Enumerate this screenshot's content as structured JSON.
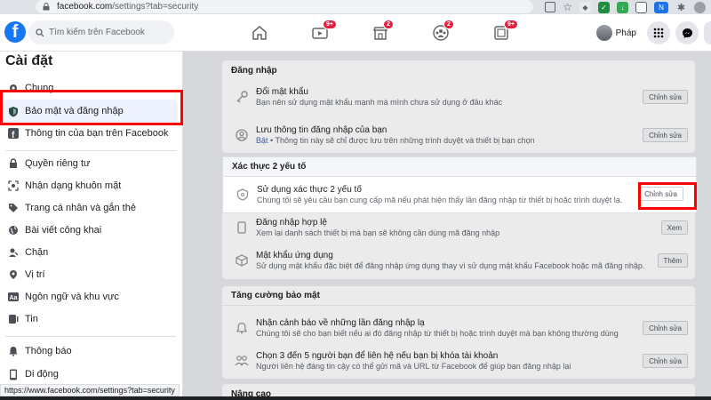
{
  "browser": {
    "url_host": "facebook.com",
    "url_path": "/settings?tab=security"
  },
  "header": {
    "search_placeholder": "Tìm kiếm trên Facebook",
    "profile_name": "Pháp",
    "badges": {
      "watch": "9+",
      "marketplace": "2",
      "groups": "2",
      "gaming": "9+"
    }
  },
  "sidebar": {
    "title": "Cài đặt",
    "items": [
      {
        "label": "Chung",
        "icon": "gear-icon"
      },
      {
        "label": "Bảo mật và đăng nhập",
        "icon": "shield-icon"
      },
      {
        "label": "Thông tin của bạn trên Facebook",
        "icon": "facebook-icon"
      },
      {
        "label": "Quyền riêng tư",
        "icon": "lock-icon"
      },
      {
        "label": "Nhận dạng khuôn mặt",
        "icon": "face-icon"
      },
      {
        "label": "Trang cá nhân và gắn thẻ",
        "icon": "tag-icon"
      },
      {
        "label": "Bài viết công khai",
        "icon": "globe-icon"
      },
      {
        "label": "Chặn",
        "icon": "block-icon"
      },
      {
        "label": "Vị trí",
        "icon": "location-icon"
      },
      {
        "label": "Ngôn ngữ và khu vực",
        "icon": "language-icon"
      },
      {
        "label": "Tin",
        "icon": "stories-icon"
      },
      {
        "label": "Thông báo",
        "icon": "bell-icon"
      },
      {
        "label": "Di động",
        "icon": "mobile-icon"
      }
    ]
  },
  "login_section": {
    "title": "Đăng nhập",
    "rows": [
      {
        "title": "Đổi mật khẩu",
        "desc": "Bạn nên sử dụng mật khẩu mạnh mà mình chưa sử dụng ở đâu khác",
        "action": "Chỉnh sửa"
      },
      {
        "title": "Lưu thông tin đăng nhập của bạn",
        "desc_on": "Bật",
        "desc": " • Thông tin này sẽ chỉ được lưu trên những trình duyệt và thiết bị bạn chọn",
        "action": "Chỉnh sửa"
      }
    ]
  },
  "twofa_section": {
    "title": "Xác thực 2 yếu tố",
    "rows": [
      {
        "title": "Sử dụng xác thực 2 yếu tố",
        "desc": "Chúng tôi sẽ yêu cầu bạn cung cấp mã nếu phát hiện thấy lần đăng nhập từ thiết bị hoặc trình duyệt lạ.",
        "action": "Chỉnh sửa"
      },
      {
        "title": "Đăng nhập hợp lệ",
        "desc": "Xem lại danh sách thiết bị mà bạn sẽ không cần dùng mã đăng nhập",
        "action": "Xem"
      },
      {
        "title": "Mật khẩu ứng dụng",
        "desc": "Sử dụng mật khẩu đặc biệt để đăng nhập ứng dụng thay vì sử dụng mật khẩu Facebook hoặc mã đăng nhập.",
        "action": "Thêm"
      }
    ]
  },
  "extra_section": {
    "title": "Tăng cường bảo mật",
    "rows": [
      {
        "title": "Nhận cảnh báo về những lần đăng nhập lạ",
        "desc": "Chúng tôi sẽ cho bạn biết nếu ai đó đăng nhập từ thiết bị hoặc trình duyệt mà bạn không thường dùng",
        "action": "Chỉnh sửa"
      },
      {
        "title": "Chọn 3 đến 5 người bạn để liên hệ nếu bạn bị khóa tài khoản",
        "desc": "Người liên hệ đáng tin cậy có thể gửi mã và URL từ Facebook để giúp bạn đăng nhập lại",
        "action": "Chỉnh sửa"
      }
    ]
  },
  "advanced_section": {
    "title": "Nâng cao"
  },
  "status_url": "https://www.facebook.com/settings?tab=security"
}
